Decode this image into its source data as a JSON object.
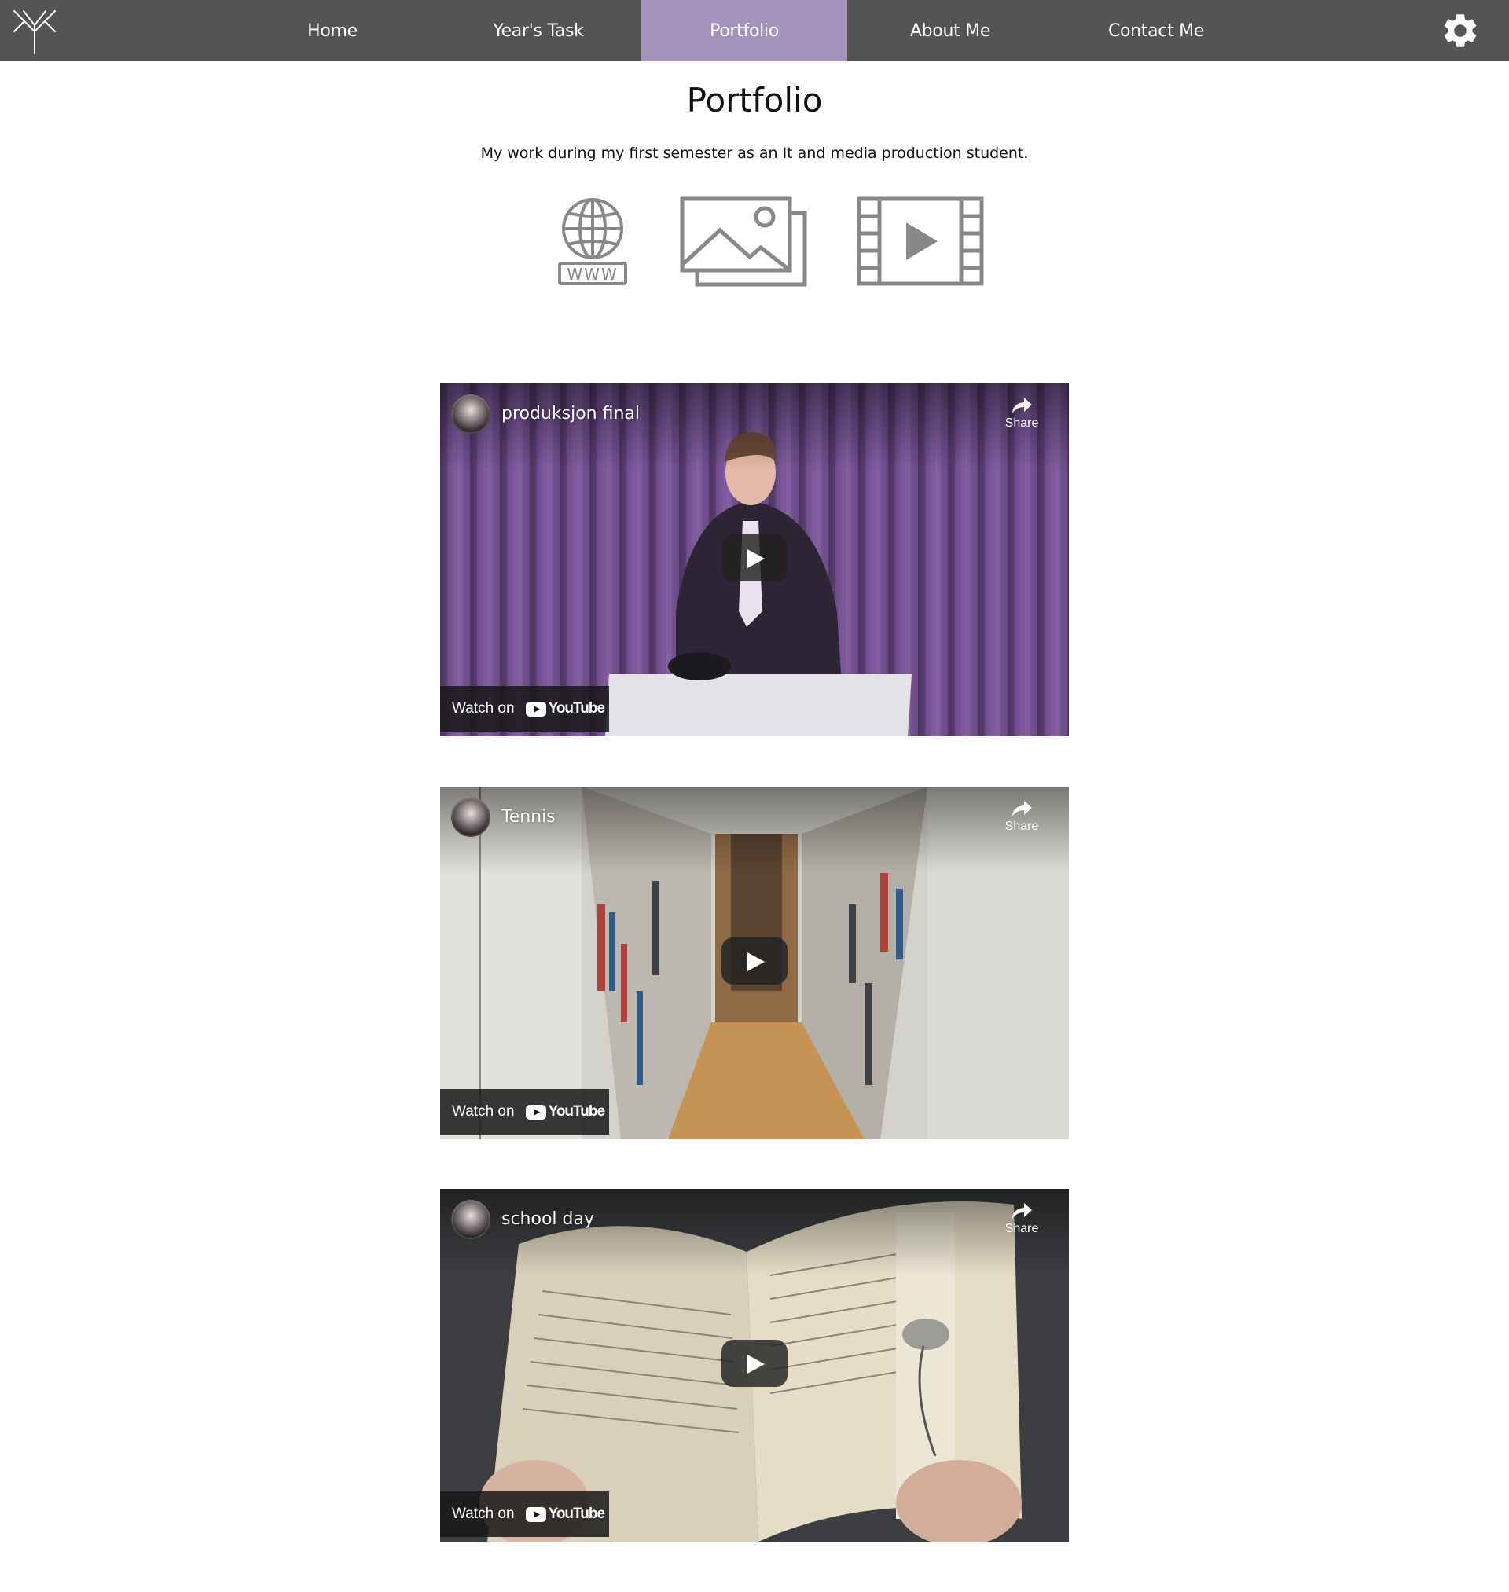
{
  "nav": {
    "items": [
      {
        "label": "Home",
        "active": false
      },
      {
        "label": "Year's Task",
        "active": false
      },
      {
        "label": "Portfolio",
        "active": true
      },
      {
        "label": "About Me",
        "active": false
      },
      {
        "label": "Contact Me",
        "active": false
      }
    ],
    "bar_color": "#545454",
    "active_color": "#a393bd"
  },
  "page": {
    "title": "Portfolio",
    "subtitle": "My work during my first semester as an It and media production student."
  },
  "category_icons": [
    "www-globe-icon",
    "image-gallery-icon",
    "video-film-icon"
  ],
  "category_icon_text": "WWW",
  "videos": [
    {
      "title": "produksjon final",
      "share_label": "Share",
      "watch_label": "Watch on",
      "brand": "YouTube"
    },
    {
      "title": "Tennis",
      "share_label": "Share",
      "watch_label": "Watch on",
      "brand": "YouTube"
    },
    {
      "title": "school day",
      "share_label": "Share",
      "watch_label": "Watch on",
      "brand": "YouTube"
    }
  ]
}
